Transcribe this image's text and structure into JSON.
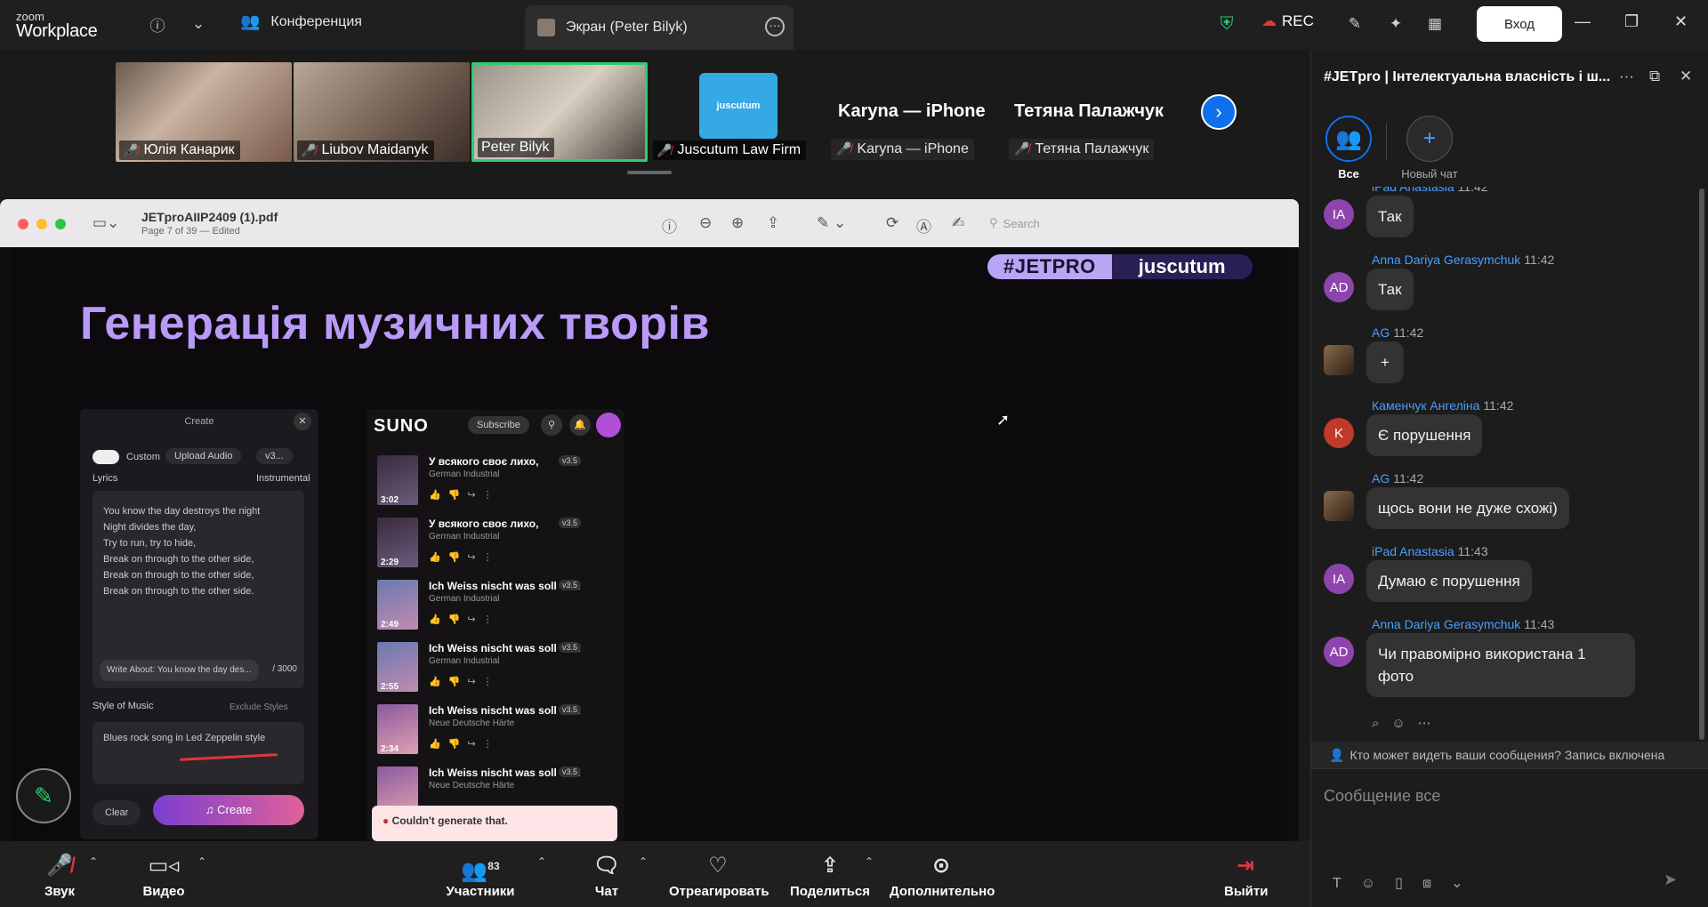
{
  "app": {
    "brand_top": "zoom",
    "brand_bottom": "Workplace"
  },
  "tabs": {
    "conference": "Конференция",
    "screen": "Экран (Peter Bilyk)"
  },
  "header": {
    "rec": "REC",
    "login": "Вход"
  },
  "participants": [
    {
      "name": "Юлія Канарик",
      "muted": true
    },
    {
      "name": "Liubov Maidanyk",
      "muted": true
    },
    {
      "name": "Peter Bilyk",
      "muted": false,
      "active": true
    },
    {
      "name": "Juscutum Law Firm",
      "muted": true
    },
    {
      "name": "Karyna — iPhone",
      "display": "Karyna — iPhone",
      "muted": true
    },
    {
      "name": "Тетяна Палажчук",
      "display": "Тетяна Палажчук",
      "muted": true
    }
  ],
  "shared": {
    "file_name": "JETproAIIP2409 (1).pdf",
    "page_info": "Page 7 of 39 — Edited",
    "search_placeholder": "Search",
    "badge_left": "#JETPRO",
    "badge_right": "juscutum",
    "slide_title": "Генерація музичних творів",
    "panel1": {
      "title": "Create",
      "custom": "Custom",
      "upload": "Upload Audio",
      "version": "v3...",
      "lyrics_label": "Lyrics",
      "instrumental": "Instrumental",
      "lyrics": [
        "You know the day destroys the night",
        "Night divides the day,",
        "Try to run, try to hide,",
        "Break on through to the other side,",
        "Break on through to the other side,",
        "Break on through to the other side."
      ],
      "write_about": "Write About: You know the day des...",
      "counter": "/ 3000",
      "style_label": "Style of Music",
      "exclude": "Exclude Styles",
      "style_value": "Blues rock song in Led Zeppelin style",
      "clear": "Clear",
      "create": "Create"
    },
    "panel2": {
      "logo": "SUNO",
      "subscribe": "Subscribe",
      "songs": [
        {
          "title": "У всякого своє лихо,",
          "genre": "German Industrial",
          "time": "3:02",
          "ver": "v3.5"
        },
        {
          "title": "У всякого своє лихо,",
          "genre": "German Industrial",
          "time": "2:29",
          "ver": "v3.5"
        },
        {
          "title": "Ich Weiss nischt was soll es...",
          "genre": "German Industrial",
          "time": "2:49",
          "ver": "v3.5"
        },
        {
          "title": "Ich Weiss nischt was soll es...",
          "genre": "German Industrial",
          "time": "2:55",
          "ver": "v3.5"
        },
        {
          "title": "Ich Weiss nischt was soll es...",
          "genre": "Neue Deutsche Härte",
          "time": "2:34",
          "ver": "v3.5"
        },
        {
          "title": "Ich Weiss nischt was soll es...",
          "genre": "Neue Deutsche Härte",
          "time": "",
          "ver": "v3.5"
        }
      ],
      "error": "Couldn't generate that."
    }
  },
  "chat": {
    "title": "#JETpro | Інтелектуальна власність і ш...",
    "filter_all": "Все",
    "filter_new": "Новый чат",
    "messages": [
      {
        "initials": "IA",
        "color": "#8e44ad",
        "name": "iPad Anastasia",
        "time": "11:42",
        "text": "Так"
      },
      {
        "initials": "AD",
        "color": "#8e44ad",
        "name": "Anna Dariya Gerasymchuk",
        "time": "11:42",
        "text": "Так"
      },
      {
        "initials": "",
        "color": "#5a4a3a",
        "name": "AG",
        "time": "11:42",
        "text": "+"
      },
      {
        "initials": "K",
        "color": "#c0392b",
        "name": "Каменчук Ангеліна",
        "time": "11:42",
        "text": "Є порушення"
      },
      {
        "initials": "",
        "color": "#5a4a3a",
        "name": "AG",
        "time": "11:42",
        "text": "щось вони не дуже схожі)"
      },
      {
        "initials": "IA",
        "color": "#8e44ad",
        "name": "iPad Anastasia",
        "time": "11:43",
        "text": "Думаю є порушення"
      },
      {
        "initials": "AD",
        "color": "#8e44ad",
        "name": "Anna Dariya Gerasymchuk",
        "time": "11:43",
        "text": "Чи правомірно використана 1 фото"
      }
    ],
    "notice": "Кто может видеть ваши сообщения? Запись включена",
    "input_placeholder": "Сообщение все"
  },
  "bottom": {
    "audio": "Звук",
    "video": "Видео",
    "participants": "Участники",
    "participants_count": "83",
    "chat": "Чат",
    "react": "Отреагировать",
    "share": "Поделиться",
    "more": "Дополнительно",
    "leave": "Выйти"
  },
  "colors": {
    "accent": "#0e71eb",
    "slide_title": "#b99af8",
    "active_tile": "#2ecc71",
    "leave": "#e0373b"
  }
}
